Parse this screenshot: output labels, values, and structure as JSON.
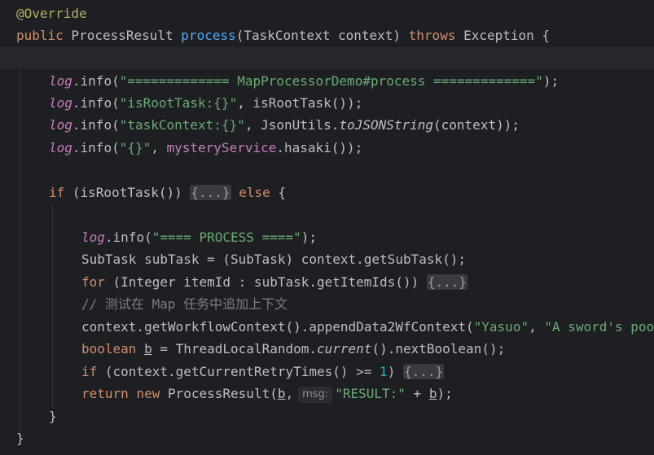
{
  "editor": {
    "partial_top": "↓",
    "annotation": "@Override",
    "sig": {
      "public": "public",
      "return_type": " ProcessResult ",
      "method": "process",
      "params": "(TaskContext context) ",
      "throws": "throws",
      "exception": " Exception {"
    },
    "log1": {
      "log": "log",
      "call": ".info(",
      "str": "\"============= MapProcessorDemo#process =============\"",
      "end": ");"
    },
    "log2": {
      "log": "log",
      "call": ".info(",
      "str": "\"isRootTask:{}\"",
      "rest": ", isRootTask());"
    },
    "log3": {
      "log": "log",
      "call": ".info(",
      "str": "\"taskContext:{}\"",
      "rest1": ", JsonUtils.",
      "method": "toJSONString",
      "rest2": "(context));"
    },
    "log4": {
      "log": "log",
      "call": ".info(",
      "str": "\"{}\"",
      "rest1": ", ",
      "field": "mysteryService",
      "rest2": ".hasaki());"
    },
    "if_root": {
      "if": "if",
      "cond": " (isRootTask()) ",
      "fold": "{...}",
      "else": "else",
      "brace": " {"
    },
    "log5": {
      "log": "log",
      "call": ".info(",
      "str": "\"==== PROCESS ====\"",
      "end": ");"
    },
    "subtask_line": "SubTask subTask = (SubTask) context.getSubTask();",
    "for_line": {
      "for": "for",
      "rest": " (Integer itemId : subTask.getItemIds()) ",
      "fold": "{...}"
    },
    "comment": "// 测试在 Map 任务中追加上下文",
    "append_line": {
      "rest": "context.getWorkflowContext().appendData2WfContext(",
      "str1": "\"Yasuo\"",
      "comma": ", ",
      "str2": "\"A sword's poor company for a long road.\"",
      "end": ");"
    },
    "bool_line": {
      "boolean": "boolean",
      "var": "b",
      "rest1": " = ThreadLocalRandom.",
      "method": "current",
      "rest2": "().nextBoolean();"
    },
    "retry_line": {
      "if": "if",
      "rest": " (context.getCurrentRetryTimes() >= ",
      "num": "1",
      "close": ") ",
      "fold": "{...}"
    },
    "return_line": {
      "return": "return",
      "new": "new",
      "rest1": " ProcessResult(",
      "var": "b",
      "comma": ",",
      "hint": "msg:",
      "str": "\"RESULT:\"",
      "plus": " + ",
      "var2": "b",
      "end": ");"
    },
    "close_inner": "}",
    "close_outer": "}"
  }
}
